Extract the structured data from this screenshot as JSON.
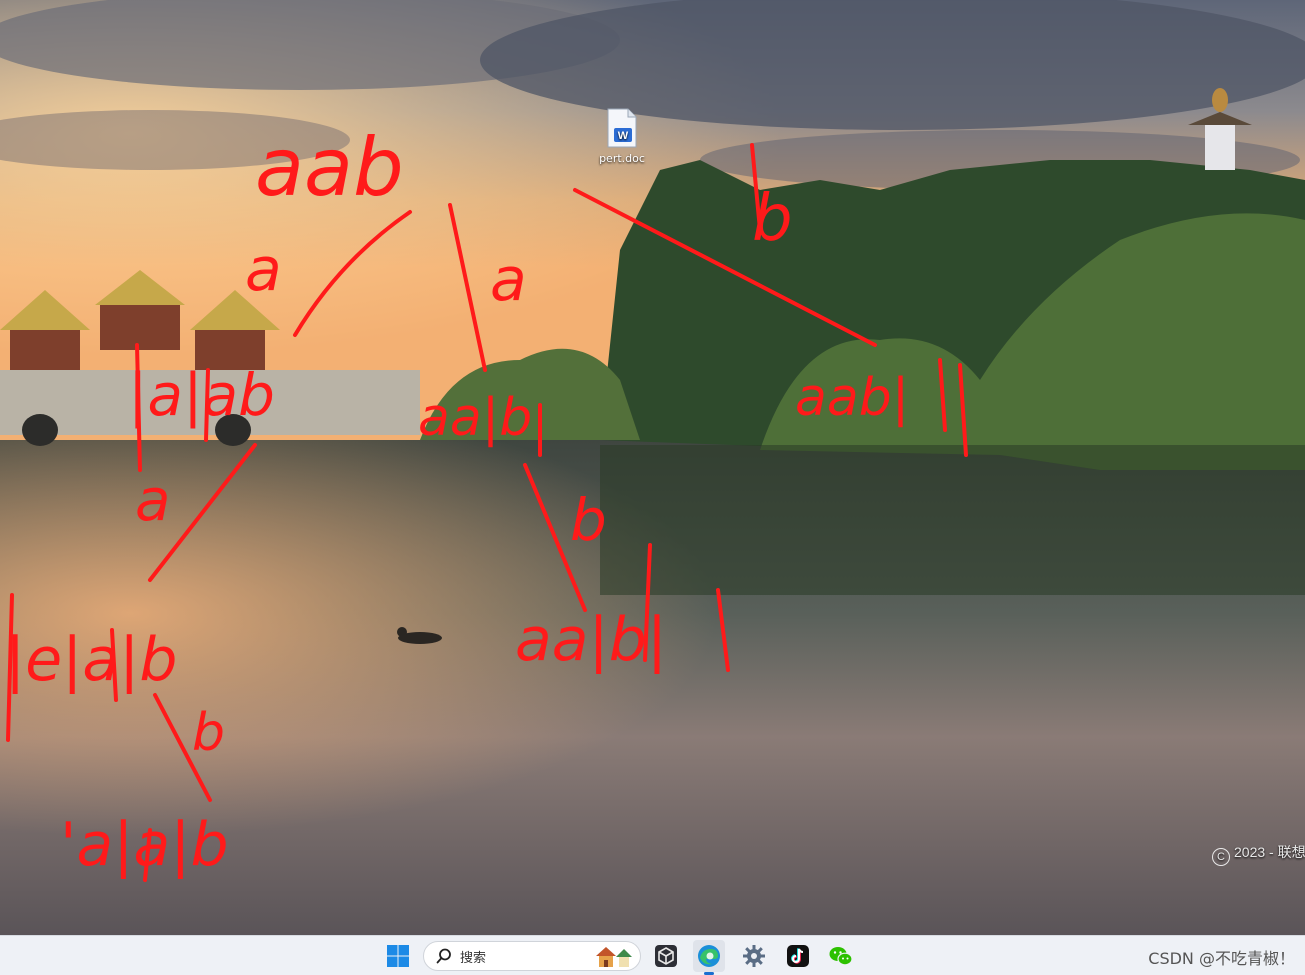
{
  "desktop": {
    "icons": [
      {
        "label": "pert.doc",
        "icon": "word-document-icon"
      }
    ],
    "watermark": "2023 - 联想",
    "annotations": [
      "aab",
      "a",
      "a",
      "b",
      "|a|ab",
      "aa|b",
      "aab|",
      "a",
      "b",
      "|e|a|b",
      "aa|b|",
      "b",
      "'a|a|b"
    ]
  },
  "taskbar": {
    "search_placeholder": "搜索",
    "apps": [
      "start-button",
      "search-box",
      "widgets",
      "app-cube",
      "edge",
      "settings",
      "tiktok",
      "wechat"
    ]
  },
  "csdn_watermark": "CSDN @不吃青椒！",
  "colors": {
    "annotation": "#ff1a1a",
    "taskbar": "#eef1f6"
  }
}
